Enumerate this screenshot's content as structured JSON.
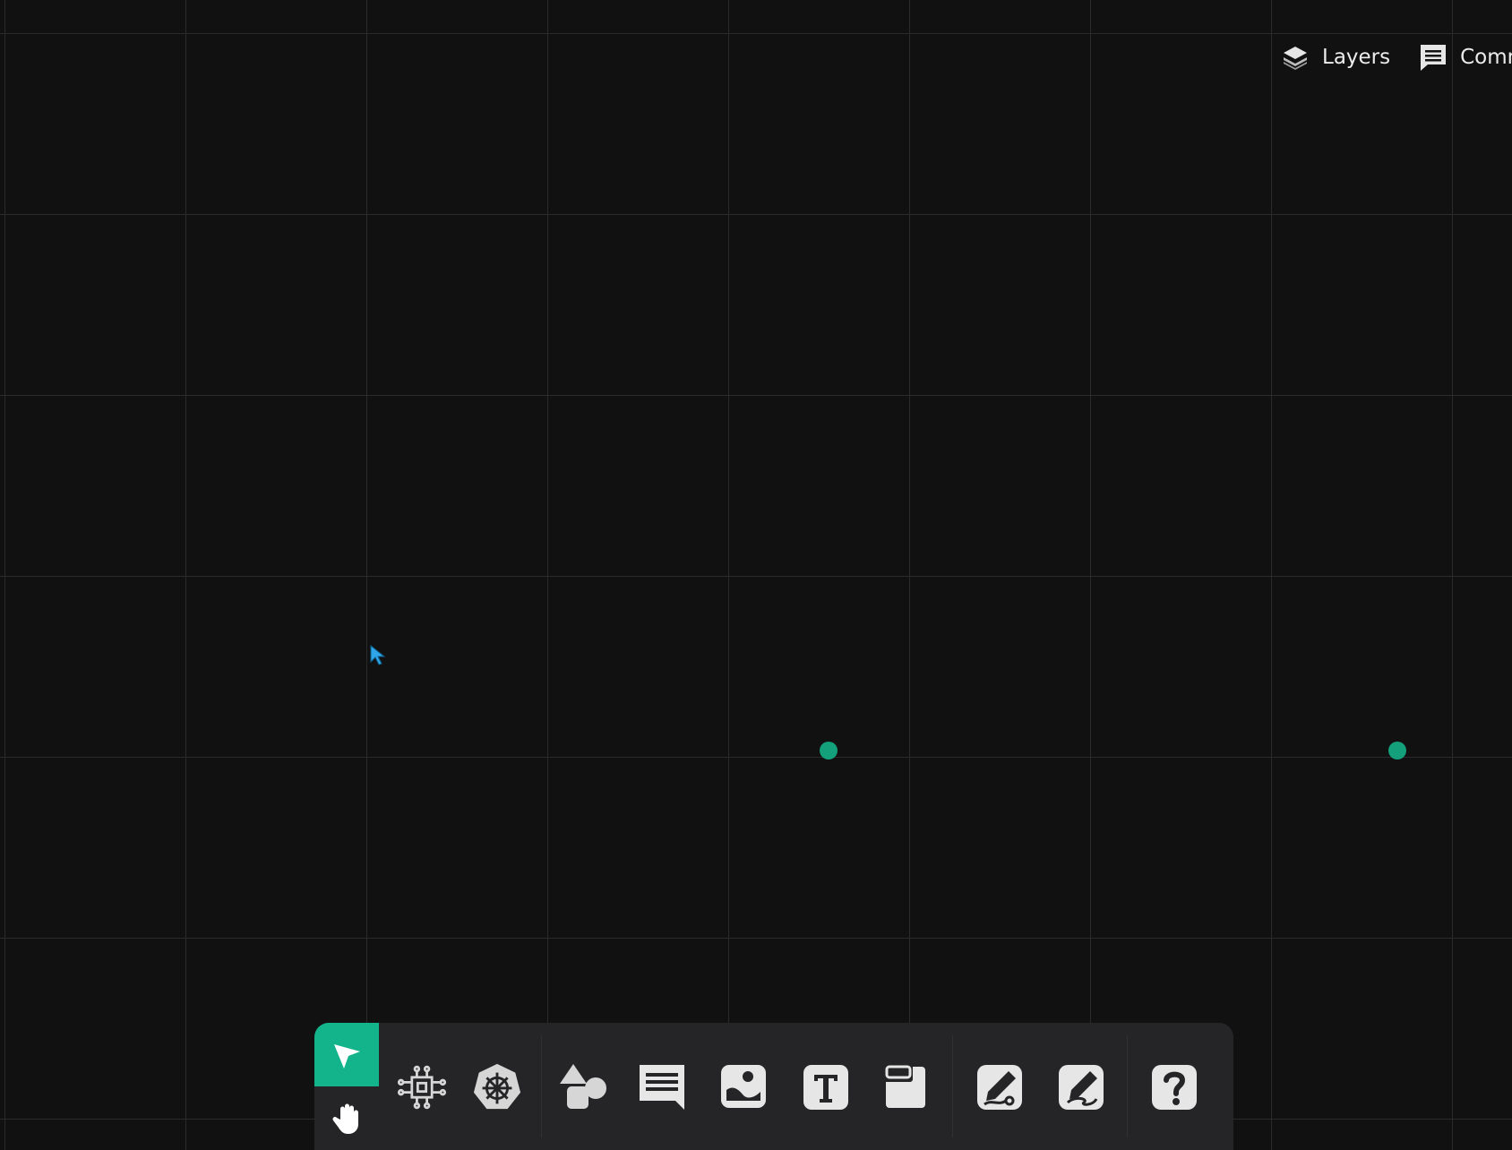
{
  "header": {
    "layers_label": "Layers",
    "comments_label": "Comm"
  },
  "toolbar": {
    "active_tool": "select",
    "tools": [
      {
        "name": "select",
        "icon": "cursor-arrow-icon"
      },
      {
        "name": "pan",
        "icon": "hand-icon"
      },
      {
        "name": "component",
        "icon": "chip-icon"
      },
      {
        "name": "kubernetes",
        "icon": "helm-wheel-icon"
      },
      {
        "name": "shapes",
        "icon": "shapes-icon"
      },
      {
        "name": "comment",
        "icon": "comment-icon"
      },
      {
        "name": "image",
        "icon": "image-icon"
      },
      {
        "name": "text",
        "icon": "text-icon"
      },
      {
        "name": "section",
        "icon": "frame-icon"
      },
      {
        "name": "connector-draw",
        "icon": "pen-connector-icon"
      },
      {
        "name": "freehand-draw",
        "icon": "pen-freehand-icon"
      },
      {
        "name": "help",
        "icon": "help-icon"
      }
    ]
  },
  "colors": {
    "accent": "#13b38c",
    "handle": "#13a07b",
    "background": "#111112",
    "grid": "#2b2b2e",
    "toolbar": "#252527",
    "icon": "#e6e6e6",
    "cursor": "#2ea6e8"
  }
}
